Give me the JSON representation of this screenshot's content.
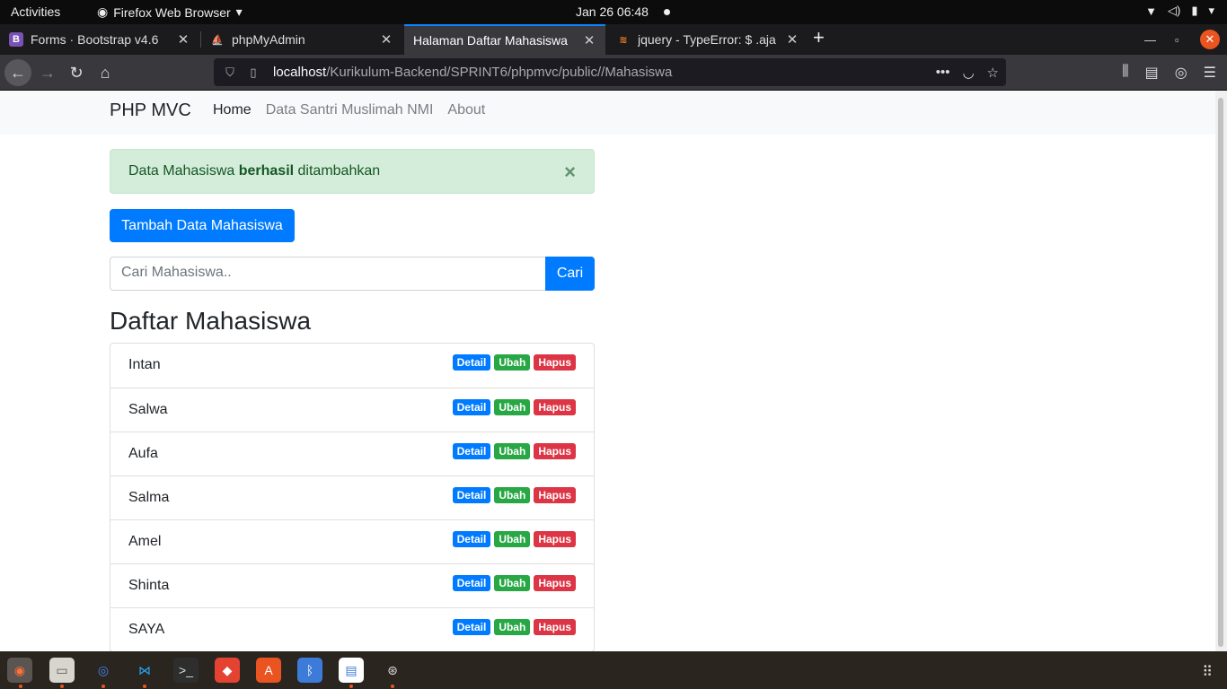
{
  "system": {
    "activities": "Activities",
    "app_name": "Firefox Web Browser",
    "clock": "Jan 26  06:48"
  },
  "browser": {
    "tabs": [
      {
        "title": "Forms · Bootstrap v4.6",
        "icon": "bootstrap-icon"
      },
      {
        "title": "phpMyAdmin",
        "icon": "phpmyadmin-icon"
      },
      {
        "title": "Halaman Daftar Mahasiswa",
        "icon": "none"
      },
      {
        "title": "jquery - TypeError: $ .aja",
        "icon": "stackoverflow-icon"
      }
    ],
    "url_host": "localhost",
    "url_path": "/Kurikulum-Backend/SPRINT6/phpmvc/public//Mahasiswa"
  },
  "page": {
    "brand": "PHP MVC",
    "nav": [
      "Home",
      "Data Santri Muslimah NMI",
      "About"
    ],
    "alert": {
      "prefix": "Data Mahasiswa ",
      "bold": "berhasil",
      "suffix": " ditambahkan",
      "close": "×"
    },
    "add_button": "Tambah Data Mahasiswa",
    "search_placeholder": "Cari Mahasiswa..",
    "search_button": "Cari",
    "heading": "Daftar Mahasiswa",
    "students": [
      "Intan",
      "Salwa",
      "Aufa",
      "Salma",
      "Amel",
      "Shinta",
      "SAYA"
    ],
    "badges": {
      "detail": "Detail",
      "ubah": "Ubah",
      "hapus": "Hapus"
    }
  },
  "colors": {
    "primary": "#007bff",
    "success": "#28a745",
    "danger": "#dc3545",
    "alert_bg": "#d4edda"
  }
}
